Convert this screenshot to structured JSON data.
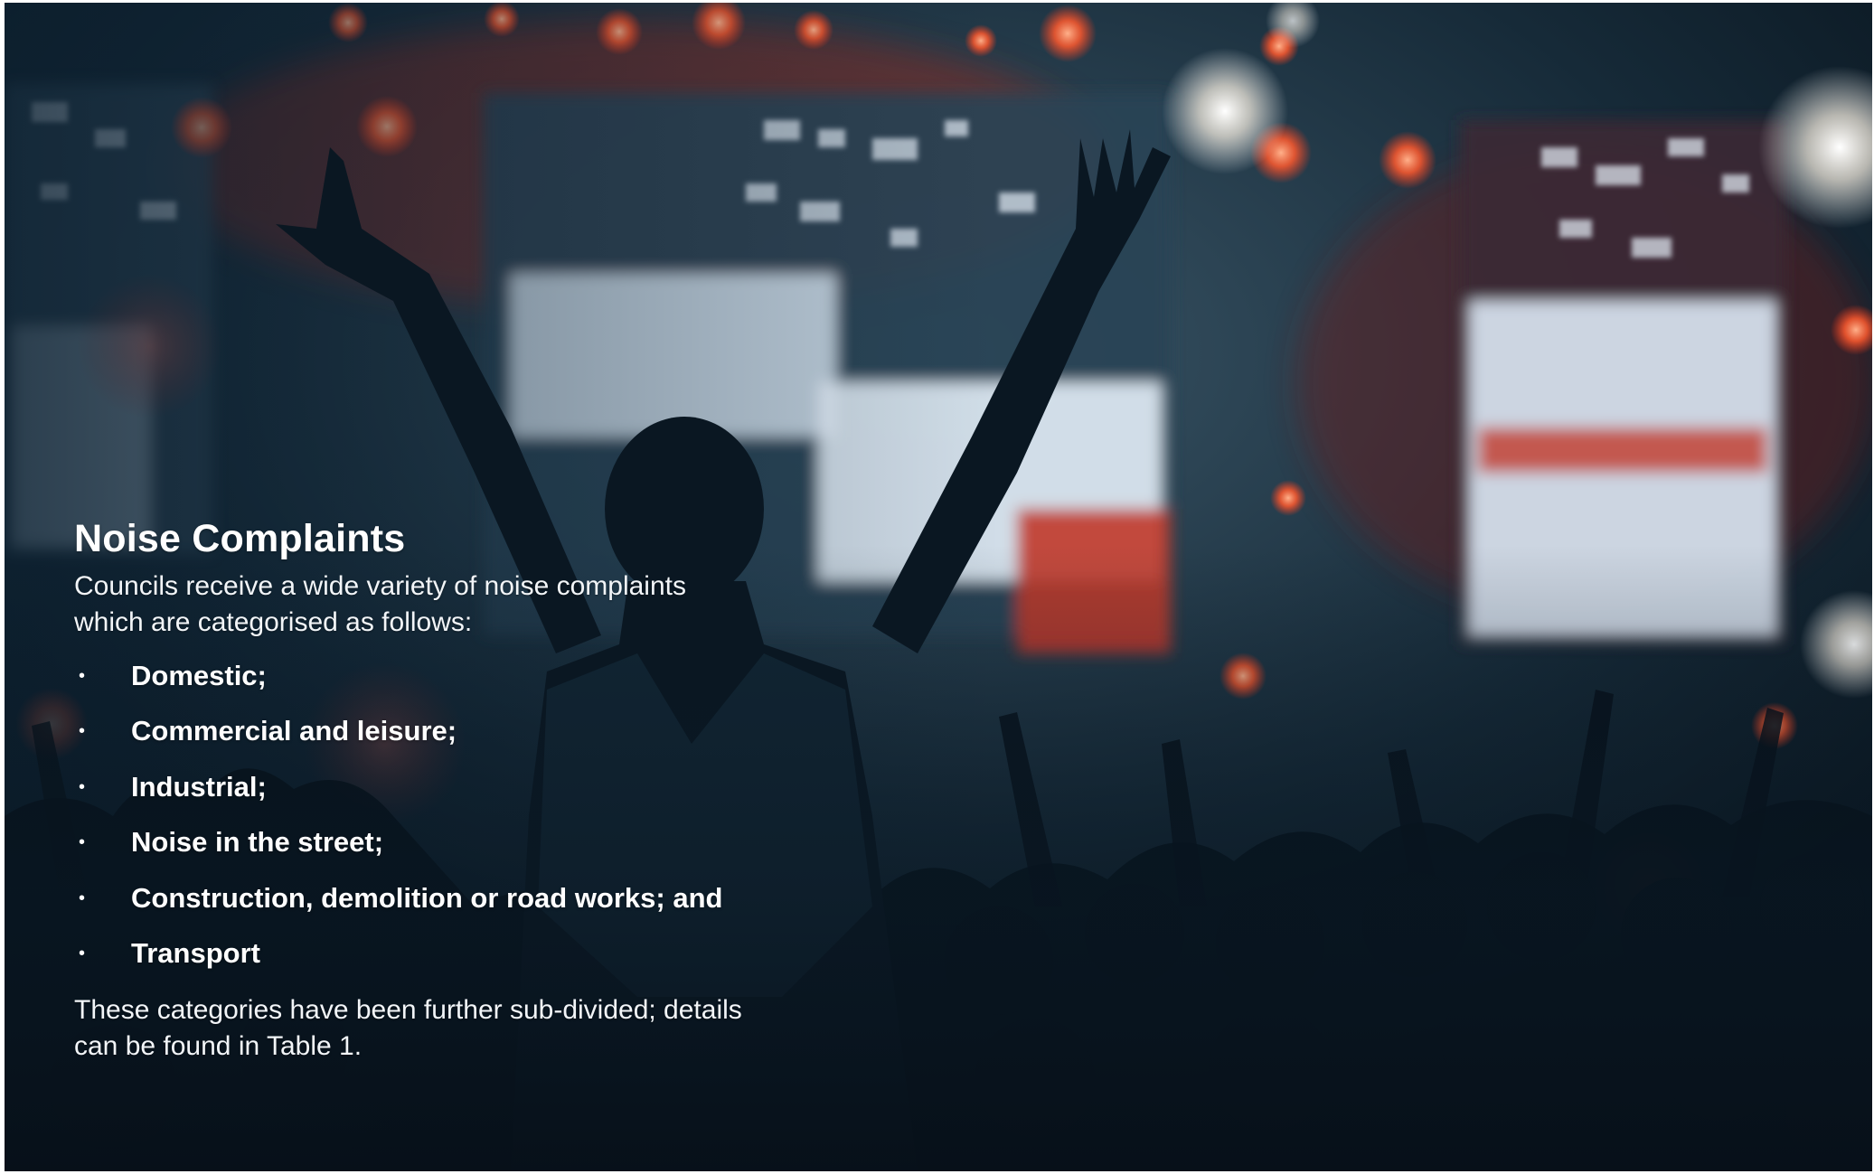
{
  "slide": {
    "title": "Noise Complaints",
    "intro": "Councils receive a wide variety of noise complaints which are categorised as follows:",
    "bullets": [
      "Domestic;",
      "Commercial and leisure;",
      "Industrial;",
      "Noise in the street;",
      "Construction, demolition or road works; and",
      "Transport"
    ],
    "bullet_glyph": "•",
    "outro": "These categories have been further sub-divided; details can be found in Table 1."
  },
  "background": {
    "icon": "concert-crowd-photo",
    "colors": {
      "base": "#0b1a28",
      "screen": "#dbe8f5",
      "stage_red": "#c0382b",
      "light_orange": "#ff6a3d",
      "silhouette": "#07111a"
    }
  }
}
